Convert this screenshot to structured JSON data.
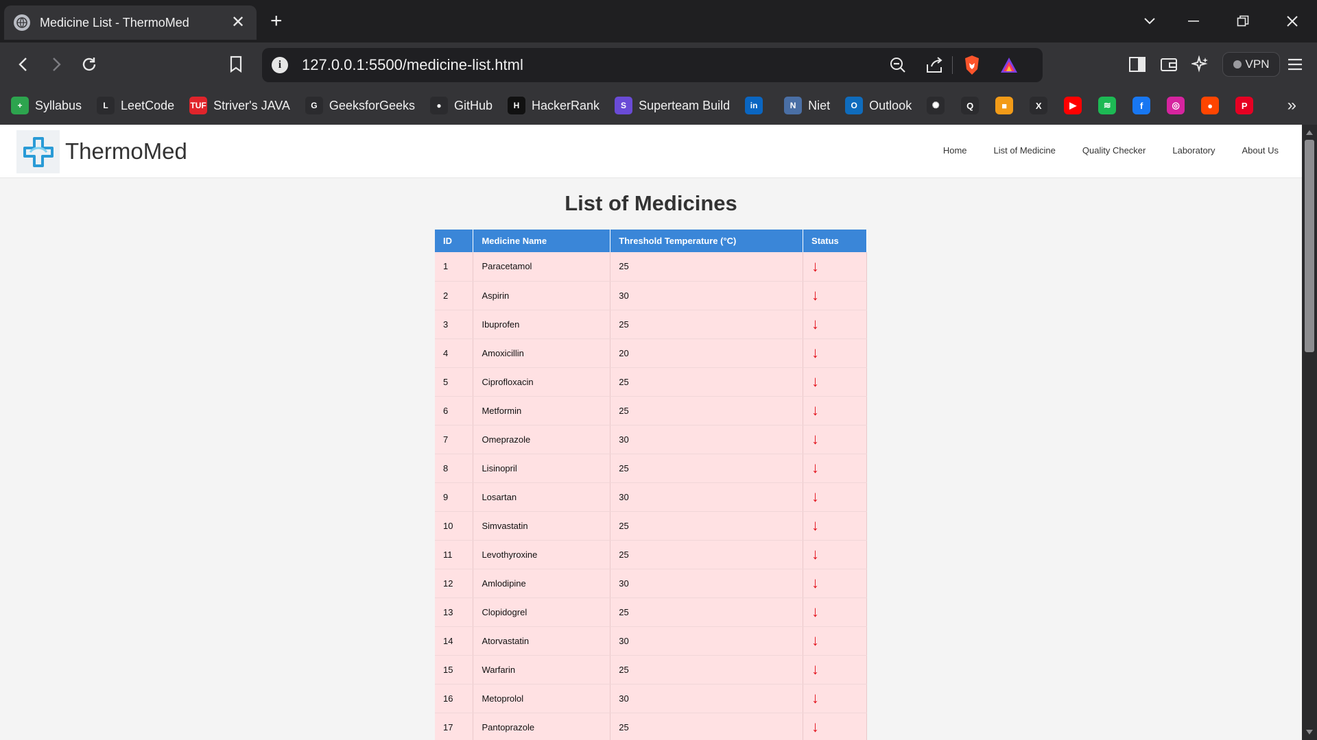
{
  "browser": {
    "tab": {
      "title": "Medicine List - ThermoMed",
      "close": "✕"
    },
    "new_tab": "+",
    "url": "127.0.0.1:5500/medicine-list.html",
    "vpn_label": "VPN",
    "bookmarks": [
      {
        "label": "Syllabus",
        "color": "#2da44e",
        "glyph": "+"
      },
      {
        "label": "LeetCode",
        "color": "#2b2b2e",
        "glyph": "L"
      },
      {
        "label": "Striver's JAVA",
        "color": "#e0242b",
        "glyph": "TUF"
      },
      {
        "label": "GeeksforGeeks",
        "color": "#2b2b2e",
        "glyph": "G"
      },
      {
        "label": "GitHub",
        "color": "#2b2b2e",
        "glyph": "●"
      },
      {
        "label": "HackerRank",
        "color": "#111111",
        "glyph": "H"
      },
      {
        "label": "Superteam Build",
        "color": "#6a4bd6",
        "glyph": "S"
      },
      {
        "label": "",
        "color": "#0a66c2",
        "glyph": "in"
      },
      {
        "label": "Niet",
        "color": "#4a6fa5",
        "glyph": "N"
      },
      {
        "label": "Outlook",
        "color": "#0f6cbd",
        "glyph": "O"
      }
    ],
    "bookmark_icons": [
      {
        "name": "chatgpt-bookmark-icon",
        "color": "#2b2b2e",
        "glyph": "✺"
      },
      {
        "name": "quora-bookmark-icon",
        "color": "#2b2b2e",
        "glyph": "Q"
      },
      {
        "name": "square-bookmark-icon",
        "color": "#f29b18",
        "glyph": "■"
      },
      {
        "name": "x-bookmark-icon",
        "color": "#2b2b2e",
        "glyph": "X"
      },
      {
        "name": "youtube-bookmark-icon",
        "color": "#ff0000",
        "glyph": "▶"
      },
      {
        "name": "spotify-bookmark-icon",
        "color": "#1db954",
        "glyph": "≋"
      },
      {
        "name": "facebook-bookmark-icon",
        "color": "#1877f2",
        "glyph": "f"
      },
      {
        "name": "instagram-bookmark-icon",
        "color": "#d6249f",
        "glyph": "◎"
      },
      {
        "name": "reddit-bookmark-icon",
        "color": "#ff4500",
        "glyph": "●"
      },
      {
        "name": "pinterest-bookmark-icon",
        "color": "#e60023",
        "glyph": "P"
      }
    ],
    "more_bookmarks": "»"
  },
  "site": {
    "brand": "ThermoMed",
    "nav": [
      "Home",
      "List of Medicine",
      "Quality Checker",
      "Laboratory",
      "About Us"
    ]
  },
  "page": {
    "title": "List of Medicines",
    "columns": [
      "ID",
      "Medicine Name",
      "Threshold Temperature (°C)",
      "Status"
    ],
    "status_glyph": "↓",
    "rows": [
      {
        "id": "1",
        "name": "Paracetamol",
        "temp": "25"
      },
      {
        "id": "2",
        "name": "Aspirin",
        "temp": "30"
      },
      {
        "id": "3",
        "name": "Ibuprofen",
        "temp": "25"
      },
      {
        "id": "4",
        "name": "Amoxicillin",
        "temp": "20"
      },
      {
        "id": "5",
        "name": "Ciprofloxacin",
        "temp": "25"
      },
      {
        "id": "6",
        "name": "Metformin",
        "temp": "25"
      },
      {
        "id": "7",
        "name": "Omeprazole",
        "temp": "30"
      },
      {
        "id": "8",
        "name": "Lisinopril",
        "temp": "25"
      },
      {
        "id": "9",
        "name": "Losartan",
        "temp": "30"
      },
      {
        "id": "10",
        "name": "Simvastatin",
        "temp": "25"
      },
      {
        "id": "11",
        "name": "Levothyroxine",
        "temp": "25"
      },
      {
        "id": "12",
        "name": "Amlodipine",
        "temp": "30"
      },
      {
        "id": "13",
        "name": "Clopidogrel",
        "temp": "25"
      },
      {
        "id": "14",
        "name": "Atorvastatin",
        "temp": "30"
      },
      {
        "id": "15",
        "name": "Warfarin",
        "temp": "25"
      },
      {
        "id": "16",
        "name": "Metoprolol",
        "temp": "30"
      },
      {
        "id": "17",
        "name": "Pantoprazole",
        "temp": "25"
      }
    ]
  },
  "colors": {
    "table_header": "#3a86d8",
    "row_bg": "#ffe1e3",
    "status_down": "#e2101a"
  }
}
